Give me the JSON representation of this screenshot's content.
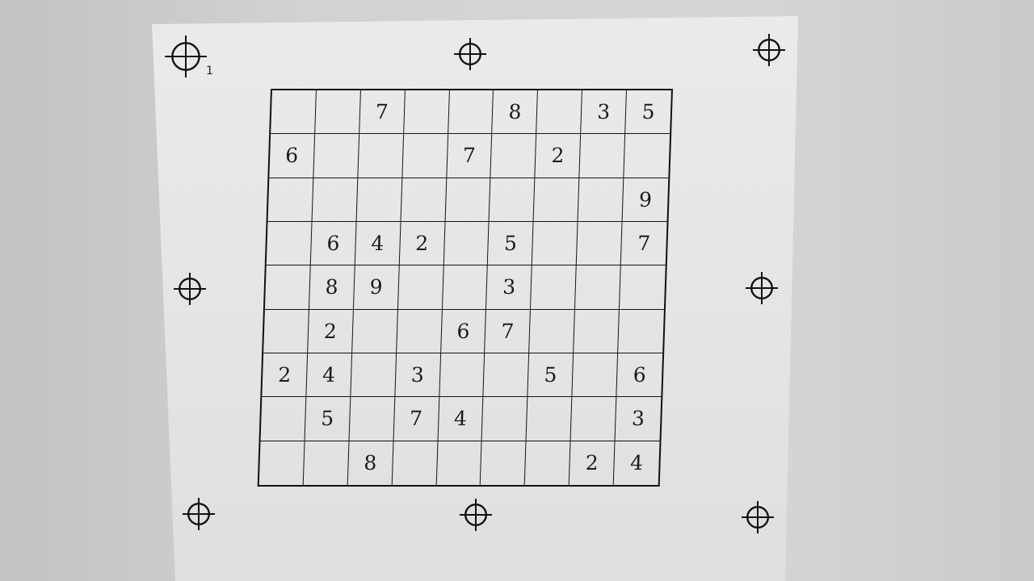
{
  "sheet": {
    "marker_label": "1"
  },
  "grid": {
    "rows": [
      [
        "",
        "",
        "7",
        "",
        "",
        "8",
        "",
        "3",
        "5"
      ],
      [
        "6",
        "",
        "",
        "",
        "7",
        "",
        "2",
        "",
        ""
      ],
      [
        "",
        "",
        "",
        "",
        "",
        "",
        "",
        "",
        "9"
      ],
      [
        "",
        "6",
        "4",
        "2",
        "",
        "5",
        "",
        "",
        "7"
      ],
      [
        "",
        "8",
        "9",
        "",
        "",
        "3",
        "",
        "",
        ""
      ],
      [
        "",
        "2",
        "",
        "",
        "6",
        "7",
        "",
        "",
        ""
      ],
      [
        "2",
        "4",
        "",
        "3",
        "",
        "",
        "5",
        "",
        "6"
      ],
      [
        "",
        "5",
        "",
        "7",
        "4",
        "",
        "",
        "",
        "3"
      ],
      [
        "",
        "",
        "8",
        "",
        "",
        "",
        "",
        "2",
        "4"
      ]
    ]
  },
  "markers": [
    {
      "icon": "crosshair-icon",
      "id": "top-left"
    },
    {
      "icon": "crosshair-icon",
      "id": "top-center"
    },
    {
      "icon": "crosshair-icon",
      "id": "top-right"
    },
    {
      "icon": "crosshair-icon",
      "id": "middle-left"
    },
    {
      "icon": "crosshair-icon",
      "id": "middle-right"
    },
    {
      "icon": "crosshair-icon",
      "id": "bottom-left"
    },
    {
      "icon": "crosshair-icon",
      "id": "bottom-center"
    },
    {
      "icon": "crosshair-icon",
      "id": "bottom-right"
    }
  ],
  "colors": {
    "ink": "#1b1b1b",
    "paper": "#e8e8e8",
    "background": "#cfcecc"
  }
}
